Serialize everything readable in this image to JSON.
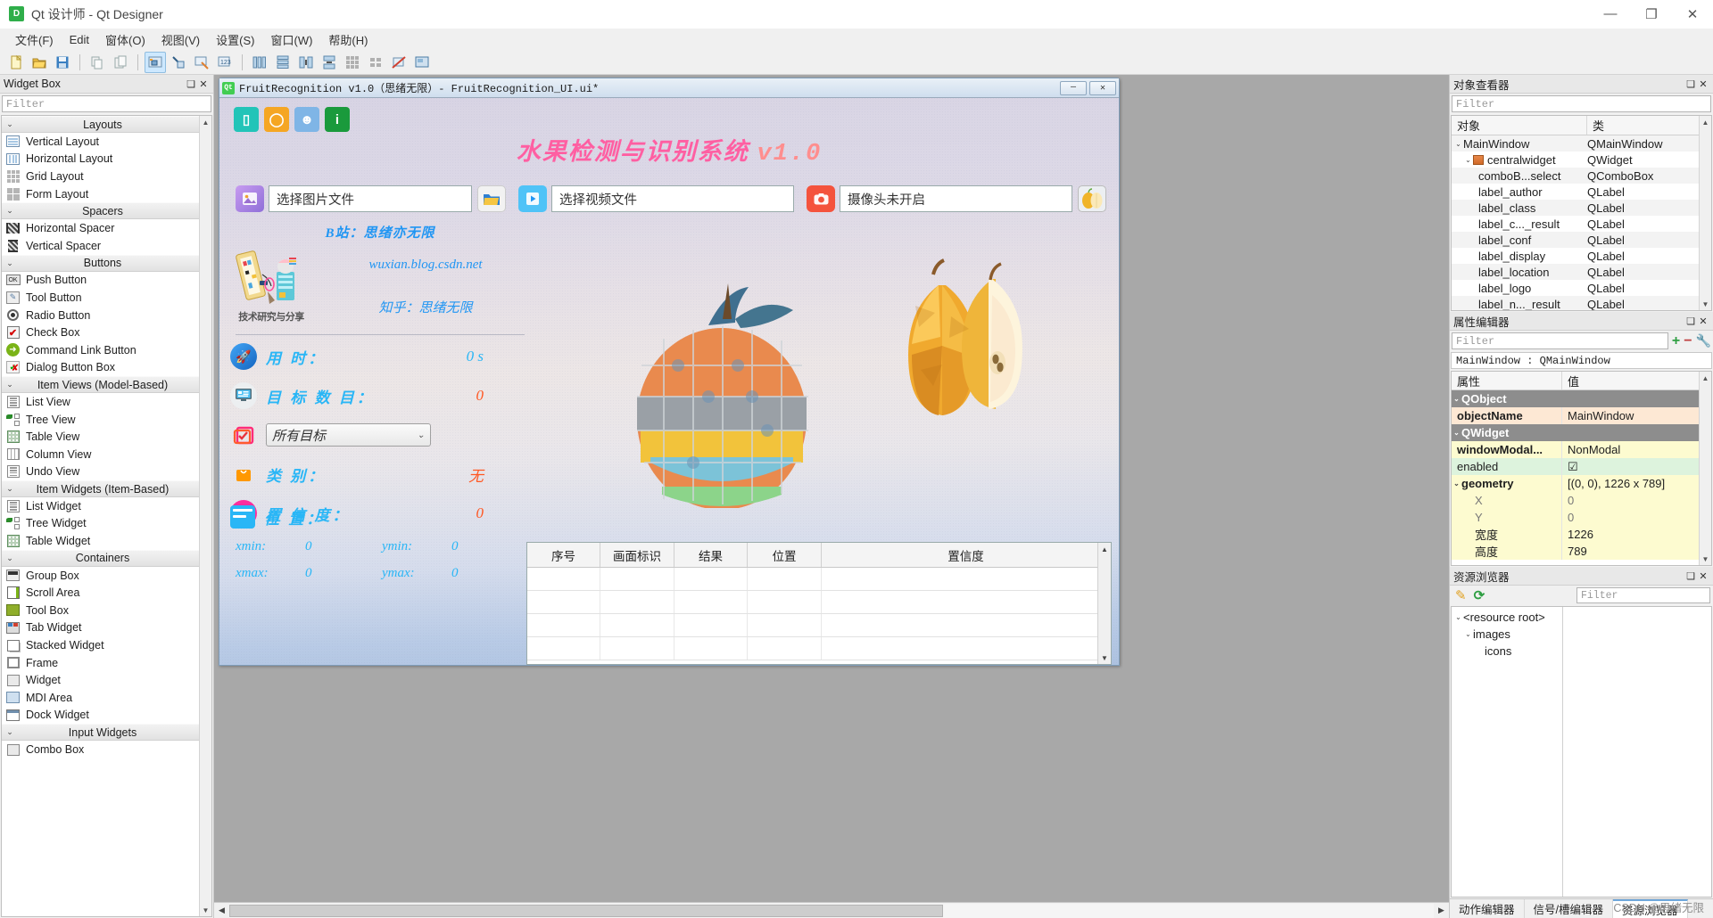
{
  "window": {
    "app_title": "Qt 设计师 - Qt Designer",
    "app_icon": "qt-designer-icon",
    "minimize": "—",
    "maximize": "❐",
    "close": "✕"
  },
  "menubar": {
    "items": [
      {
        "label": "文件(F)"
      },
      {
        "label": "Edit"
      },
      {
        "label": "窗体(O)"
      },
      {
        "label": "视图(V)"
      },
      {
        "label": "设置(S)"
      },
      {
        "label": "窗口(W)"
      },
      {
        "label": "帮助(H)"
      }
    ]
  },
  "widget_box": {
    "title": "Widget Box",
    "filter_placeholder": "Filter",
    "float_icon": "restore-icon",
    "close_icon": "close-icon",
    "categories": [
      {
        "name": "Layouts",
        "items": [
          {
            "label": "Vertical Layout",
            "icon": "vertical-layout-icon"
          },
          {
            "label": "Horizontal Layout",
            "icon": "horizontal-layout-icon"
          },
          {
            "label": "Grid Layout",
            "icon": "grid-layout-icon"
          },
          {
            "label": "Form Layout",
            "icon": "form-layout-icon"
          }
        ]
      },
      {
        "name": "Spacers",
        "items": [
          {
            "label": "Horizontal Spacer",
            "icon": "horizontal-spacer-icon"
          },
          {
            "label": "Vertical Spacer",
            "icon": "vertical-spacer-icon"
          }
        ]
      },
      {
        "name": "Buttons",
        "items": [
          {
            "label": "Push Button",
            "icon": "push-button-icon"
          },
          {
            "label": "Tool Button",
            "icon": "tool-button-icon"
          },
          {
            "label": "Radio Button",
            "icon": "radio-button-icon"
          },
          {
            "label": "Check Box",
            "icon": "check-box-icon"
          },
          {
            "label": "Command Link Button",
            "icon": "command-link-icon"
          },
          {
            "label": "Dialog Button Box",
            "icon": "dialog-button-box-icon"
          }
        ]
      },
      {
        "name": "Item Views (Model-Based)",
        "items": [
          {
            "label": "List View",
            "icon": "list-view-icon"
          },
          {
            "label": "Tree View",
            "icon": "tree-view-icon"
          },
          {
            "label": "Table View",
            "icon": "table-view-icon"
          },
          {
            "label": "Column View",
            "icon": "column-view-icon"
          },
          {
            "label": "Undo View",
            "icon": "undo-view-icon"
          }
        ]
      },
      {
        "name": "Item Widgets (Item-Based)",
        "items": [
          {
            "label": "List Widget",
            "icon": "list-widget-icon"
          },
          {
            "label": "Tree Widget",
            "icon": "tree-widget-icon"
          },
          {
            "label": "Table Widget",
            "icon": "table-widget-icon"
          }
        ]
      },
      {
        "name": "Containers",
        "items": [
          {
            "label": "Group Box",
            "icon": "group-box-icon"
          },
          {
            "label": "Scroll Area",
            "icon": "scroll-area-icon"
          },
          {
            "label": "Tool Box",
            "icon": "tool-box-icon"
          },
          {
            "label": "Tab Widget",
            "icon": "tab-widget-icon"
          },
          {
            "label": "Stacked Widget",
            "icon": "stacked-widget-icon"
          },
          {
            "label": "Frame",
            "icon": "frame-icon"
          },
          {
            "label": "Widget",
            "icon": "widget-icon"
          },
          {
            "label": "MDI Area",
            "icon": "mdi-area-icon"
          },
          {
            "label": "Dock Widget",
            "icon": "dock-widget-icon"
          }
        ]
      },
      {
        "name": "Input Widgets",
        "items": [
          {
            "label": "Combo Box",
            "icon": "combo-box-icon"
          }
        ]
      }
    ]
  },
  "form_window": {
    "title": "FruitRecognition v1.0（思绪无限）- FruitRecognition_UI.ui*",
    "qt_badge": "Qt",
    "minimize": "—",
    "close": "✕",
    "toolbuttons": [
      {
        "name": "mobile-icon",
        "glyph": "▯",
        "color": "#22c4b8"
      },
      {
        "name": "drop-icon",
        "glyph": "◯",
        "color": "#f5a623"
      },
      {
        "name": "user-icon",
        "glyph": "☻",
        "color": "#6aa9e0"
      },
      {
        "name": "info-icon",
        "glyph": "i",
        "color": "#1a9a3c"
      }
    ],
    "heading": "水果检测与识别系统",
    "heading_version": "v1.0",
    "inputs": [
      {
        "icon": "image-file-icon",
        "icon_color": "#b07ce8",
        "value": "选择图片文件"
      },
      {
        "icon": "folder-open-icon",
        "icon_color": "#f7c948",
        "value": ""
      },
      {
        "icon": "video-play-icon",
        "icon_color": "#4fc3f7",
        "value": "选择视频文件"
      },
      {
        "icon": "camera-icon",
        "icon_color": "#f4533d",
        "value": "摄像头未开启"
      },
      {
        "icon": "fruit-icon",
        "icon_color": "#f2d06b",
        "value": ""
      }
    ],
    "branding": {
      "bilibili": "B站：思绪亦无限",
      "blog": "wuxian.blog.csdn.net",
      "zhihu": "知乎：思绪无限",
      "logo_caption": "技术研究与分享"
    },
    "stats": [
      {
        "icon": "rocket-icon",
        "icon_color": "#2196f3",
        "label": "用 时：",
        "value": "0 s",
        "value_color": "#29b6f6"
      },
      {
        "icon": "monitor-icon",
        "icon_color": "#e8e8e8",
        "label": "目 标 数 目：",
        "value": "0",
        "value_color": "#ff5722"
      },
      {
        "icon": "checklist-icon",
        "icon_color": "#ffffff",
        "combo_value": "所有目标",
        "combo_arrow": "⌄"
      },
      {
        "icon": "bag-icon",
        "icon_color": "#ff9800",
        "label": "类 别：",
        "value": "无",
        "value_color": "#ff5722"
      },
      {
        "icon": "confidence-icon",
        "icon_color": "#ff3fa4",
        "label": "置 信 度：",
        "value": "0",
        "value_color": "#ff5722"
      }
    ],
    "position": {
      "icon": "location-icon",
      "label": "位 置：",
      "rows": [
        {
          "k1": "xmin:",
          "v1": "0",
          "k2": "ymin:",
          "v2": "0"
        },
        {
          "k1": "xmax:",
          "v1": "0",
          "k2": "ymax:",
          "v2": "0"
        }
      ]
    },
    "table": {
      "headers": [
        "序号",
        "画面标识",
        "结果",
        "位置",
        "置信度"
      ],
      "rows": [
        [],
        [],
        [],
        []
      ]
    }
  },
  "object_inspector": {
    "title": "对象查看器",
    "float_icon": "restore-icon",
    "close_icon": "close-icon",
    "filter_placeholder": "Filter",
    "columns": [
      "对象",
      "类"
    ],
    "rows": [
      {
        "name": "MainWindow",
        "class": "QMainWindow",
        "indent": 0,
        "expander": "⌄"
      },
      {
        "name": "centralwidget",
        "class": "QWidget",
        "indent": 1,
        "expander": "⌄",
        "icon": "widget-icon"
      },
      {
        "name": "comboB...select",
        "class": "QComboBox",
        "indent": 2,
        "expander": ""
      },
      {
        "name": "label_author",
        "class": "QLabel",
        "indent": 2,
        "expander": ""
      },
      {
        "name": "label_class",
        "class": "QLabel",
        "indent": 2,
        "expander": ""
      },
      {
        "name": "label_c..._result",
        "class": "QLabel",
        "indent": 2,
        "expander": ""
      },
      {
        "name": "label_conf",
        "class": "QLabel",
        "indent": 2,
        "expander": ""
      },
      {
        "name": "label_display",
        "class": "QLabel",
        "indent": 2,
        "expander": ""
      },
      {
        "name": "label_location",
        "class": "QLabel",
        "indent": 2,
        "expander": ""
      },
      {
        "name": "label_logo",
        "class": "QLabel",
        "indent": 2,
        "expander": ""
      },
      {
        "name": "label_n..._result",
        "class": "QLabel",
        "indent": 2,
        "expander": ""
      }
    ]
  },
  "property_editor": {
    "title": "属性编辑器",
    "float_icon": "restore-icon",
    "close_icon": "close-icon",
    "filter_placeholder": "Filter",
    "add_icon": "plus-icon",
    "remove_icon": "minus-icon",
    "config_icon": "wrench-icon",
    "target": "MainWindow : QMainWindow",
    "columns": [
      "属性",
      "值"
    ],
    "groups": [
      {
        "name": "QObject",
        "rows": [
          {
            "key": "objectName",
            "value": "MainWindow",
            "style": "name"
          }
        ]
      },
      {
        "name": "QWidget",
        "rows": [
          {
            "key": "windowModal...",
            "value": "NonModal",
            "style": "bold"
          },
          {
            "key": "enabled",
            "value": "☑",
            "style": "plain"
          },
          {
            "key": "geometry",
            "value": "[(0, 0), 1226 x 789]",
            "style": "bold",
            "expander": "⌄"
          },
          {
            "key": "X",
            "value": "0",
            "style": "sub"
          },
          {
            "key": "Y",
            "value": "0",
            "style": "sub"
          },
          {
            "key": "宽度",
            "value": "1226",
            "style": "sub"
          },
          {
            "key": "高度",
            "value": "789",
            "style": "sub"
          }
        ]
      }
    ]
  },
  "resource_browser": {
    "title": "资源浏览器",
    "float_icon": "restore-icon",
    "close_icon": "close-icon",
    "edit_icon": "pencil-icon",
    "reload_icon": "refresh-icon",
    "filter_placeholder": "Filter",
    "tree": [
      {
        "label": "<resource root>",
        "indent": 0,
        "expander": "⌄"
      },
      {
        "label": "images",
        "indent": 1,
        "expander": "⌄"
      },
      {
        "label": "icons",
        "indent": 2,
        "expander": ""
      }
    ]
  },
  "bottom_tabs": {
    "items": [
      {
        "label": "动作编辑器",
        "active": false
      },
      {
        "label": "信号/槽编辑器",
        "active": false
      },
      {
        "label": "资源浏览器",
        "active": true
      }
    ]
  },
  "watermark": "CSDN @思绪无限",
  "toolbar": {
    "buttons": [
      {
        "name": "new-form-icon",
        "group": 0
      },
      {
        "name": "open-form-icon",
        "group": 0
      },
      {
        "name": "save-form-icon",
        "group": 0
      },
      {
        "name": "copy-icon",
        "group": 1
      },
      {
        "name": "paste-icon",
        "group": 1
      },
      {
        "name": "edit-widgets-icon",
        "group": 2,
        "active": true
      },
      {
        "name": "edit-signals-icon",
        "group": 2
      },
      {
        "name": "edit-buddies-icon",
        "group": 2
      },
      {
        "name": "edit-tab-order-icon",
        "group": 2
      },
      {
        "name": "layout-horizontal-icon",
        "group": 3
      },
      {
        "name": "layout-vertical-icon",
        "group": 3
      },
      {
        "name": "layout-splitter-h-icon",
        "group": 3
      },
      {
        "name": "layout-splitter-v-icon",
        "group": 3
      },
      {
        "name": "layout-grid-icon",
        "group": 3
      },
      {
        "name": "layout-form-icon",
        "group": 3
      },
      {
        "name": "break-layout-icon",
        "group": 3
      },
      {
        "name": "adjust-size-icon",
        "group": 3
      }
    ]
  }
}
